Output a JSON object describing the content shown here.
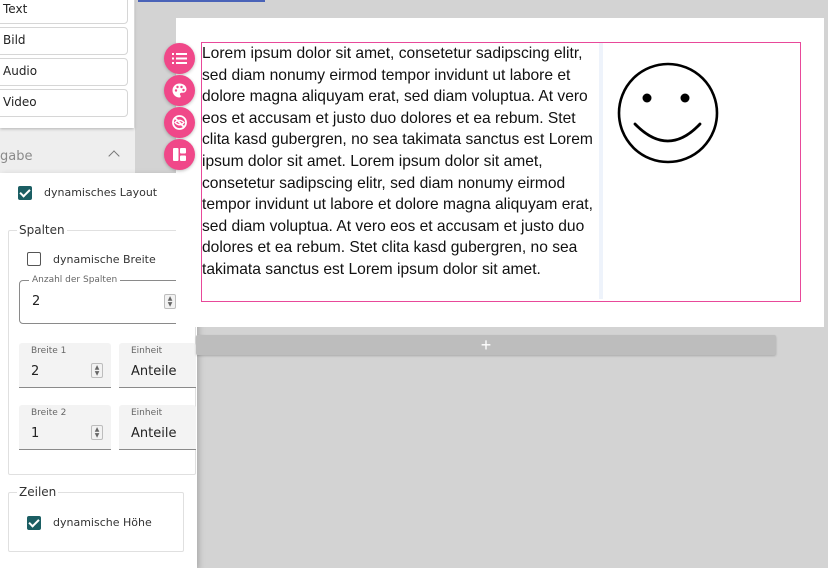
{
  "palette": {
    "items": [
      {
        "label": "Text"
      },
      {
        "label": "Bild"
      },
      {
        "label": "Audio"
      },
      {
        "label": "Video"
      }
    ],
    "section_label": "gabe"
  },
  "settings": {
    "dynamic_layout": {
      "label": "dynamisches Layout",
      "checked": true
    },
    "columns": {
      "legend": "Spalten",
      "dynamic_width": {
        "label": "dynamische Breite",
        "checked": false
      },
      "count": {
        "label": "Anzahl der Spalten",
        "value": "2"
      },
      "widths": [
        {
          "label": "Breite 1",
          "value": "2",
          "unit_label": "Einheit",
          "unit_value": "Anteile"
        },
        {
          "label": "Breite 2",
          "value": "1",
          "unit_label": "Einheit",
          "unit_value": "Anteile"
        }
      ]
    },
    "rows": {
      "legend": "Zeilen",
      "dynamic_height": {
        "label": "dynamische Höhe",
        "checked": true
      }
    }
  },
  "toolbar": {
    "icons": [
      "list-icon",
      "palette-icon",
      "eye-off-icon",
      "layout-icon"
    ],
    "accent": "#f04889"
  },
  "content": {
    "paragraph": "Lorem ipsum dolor sit amet, consetetur sadipscing elitr, sed diam nonumy eirmod tempor invidunt ut labore et dolore magna aliquyam erat, sed diam voluptua. At vero eos et accusam et justo duo dolores et ea rebum. Stet clita kasd gubergren, no sea takimata sanctus est Lorem ipsum dolor sit amet. Lorem ipsum dolor sit amet, consetetur sadipscing elitr, sed diam nonumy eirmod tempor invidunt ut labore et dolore magna aliquyam erat, sed diam voluptua. At vero eos et accusam et justo duo dolores et ea rebum. Stet clita kasd gubergren, no sea takimata sanctus est Lorem ipsum dolor sit amet.",
    "image": "smiley-face",
    "selection_color": "#e8499a"
  },
  "add_row": {
    "label": "+"
  }
}
